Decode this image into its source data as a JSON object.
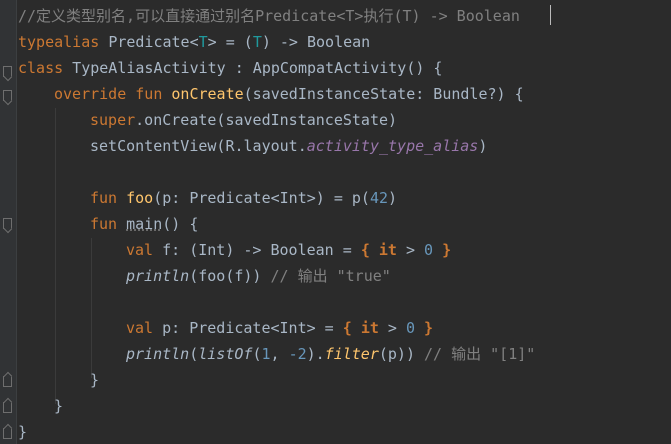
{
  "editor": {
    "lines": {
      "l1": {
        "comment": "//定义类型别名,可以直接通过别名Predicate<T>执行(T) -> Boolean"
      },
      "l2": {
        "kw": "typealias",
        "name": "Predicate",
        "tparam_open": "<",
        "tparam": "T",
        "tparam_close": ">",
        "eq": " = (",
        "tparam2": "T",
        "rest": ") -> Boolean"
      },
      "l3": {
        "kw": "class",
        "rest": " TypeAliasActivity : AppCompatActivity() {"
      },
      "l4": {
        "kw1": "override",
        "kw2": "fun",
        "fn": "onCreate",
        "rest": "(savedInstanceState: Bundle?) {"
      },
      "l5": {
        "kw": "super",
        "rest": ".onCreate(savedInstanceState)"
      },
      "l6": {
        "pre": "setContentView(R.layout.",
        "field": "activity_type_alias",
        "post": ")"
      },
      "l8": {
        "kw": "fun",
        "fn": "foo",
        "mid": "(p: Predicate<Int>) = p(",
        "num": "42",
        "post": ")"
      },
      "l9": {
        "kw": "fun",
        "fn": "main",
        "post": "() {"
      },
      "l10": {
        "kw": "val",
        "mid": " f: (Int) -> Boolean = ",
        "lb": "{",
        "it": "it",
        "gt": " > ",
        "num": "0",
        "rb": "}"
      },
      "l11": {
        "fn": "println",
        "mid": "(foo(f)) ",
        "comment": "// 输出 \"true\""
      },
      "l13": {
        "kw": "val",
        "mid": " p: Predicate<Int> = ",
        "lb": "{",
        "it": "it",
        "gt": " > ",
        "num": "0",
        "rb": "}"
      },
      "l14": {
        "fn": "println",
        "p1": "(",
        "listof": "listOf",
        "p2": "(",
        "n1": "1",
        "comma": ", ",
        "n2": "-2",
        "p3": ").",
        "filter": "filter",
        "p4": "(p)) ",
        "comment": "// 输出 \"[1]\""
      },
      "l15": {
        "text": "}"
      },
      "l16": {
        "text": "}"
      },
      "l17": {
        "text": "}"
      }
    }
  },
  "colors": {
    "background": "#2b2b2b",
    "keyword": "#cc7832",
    "comment": "#808080",
    "function": "#ffc66d",
    "number": "#6897bb",
    "string": "#6a8759",
    "field": "#9876aa",
    "type_param": "#20999d",
    "default": "#a9b7c6"
  }
}
